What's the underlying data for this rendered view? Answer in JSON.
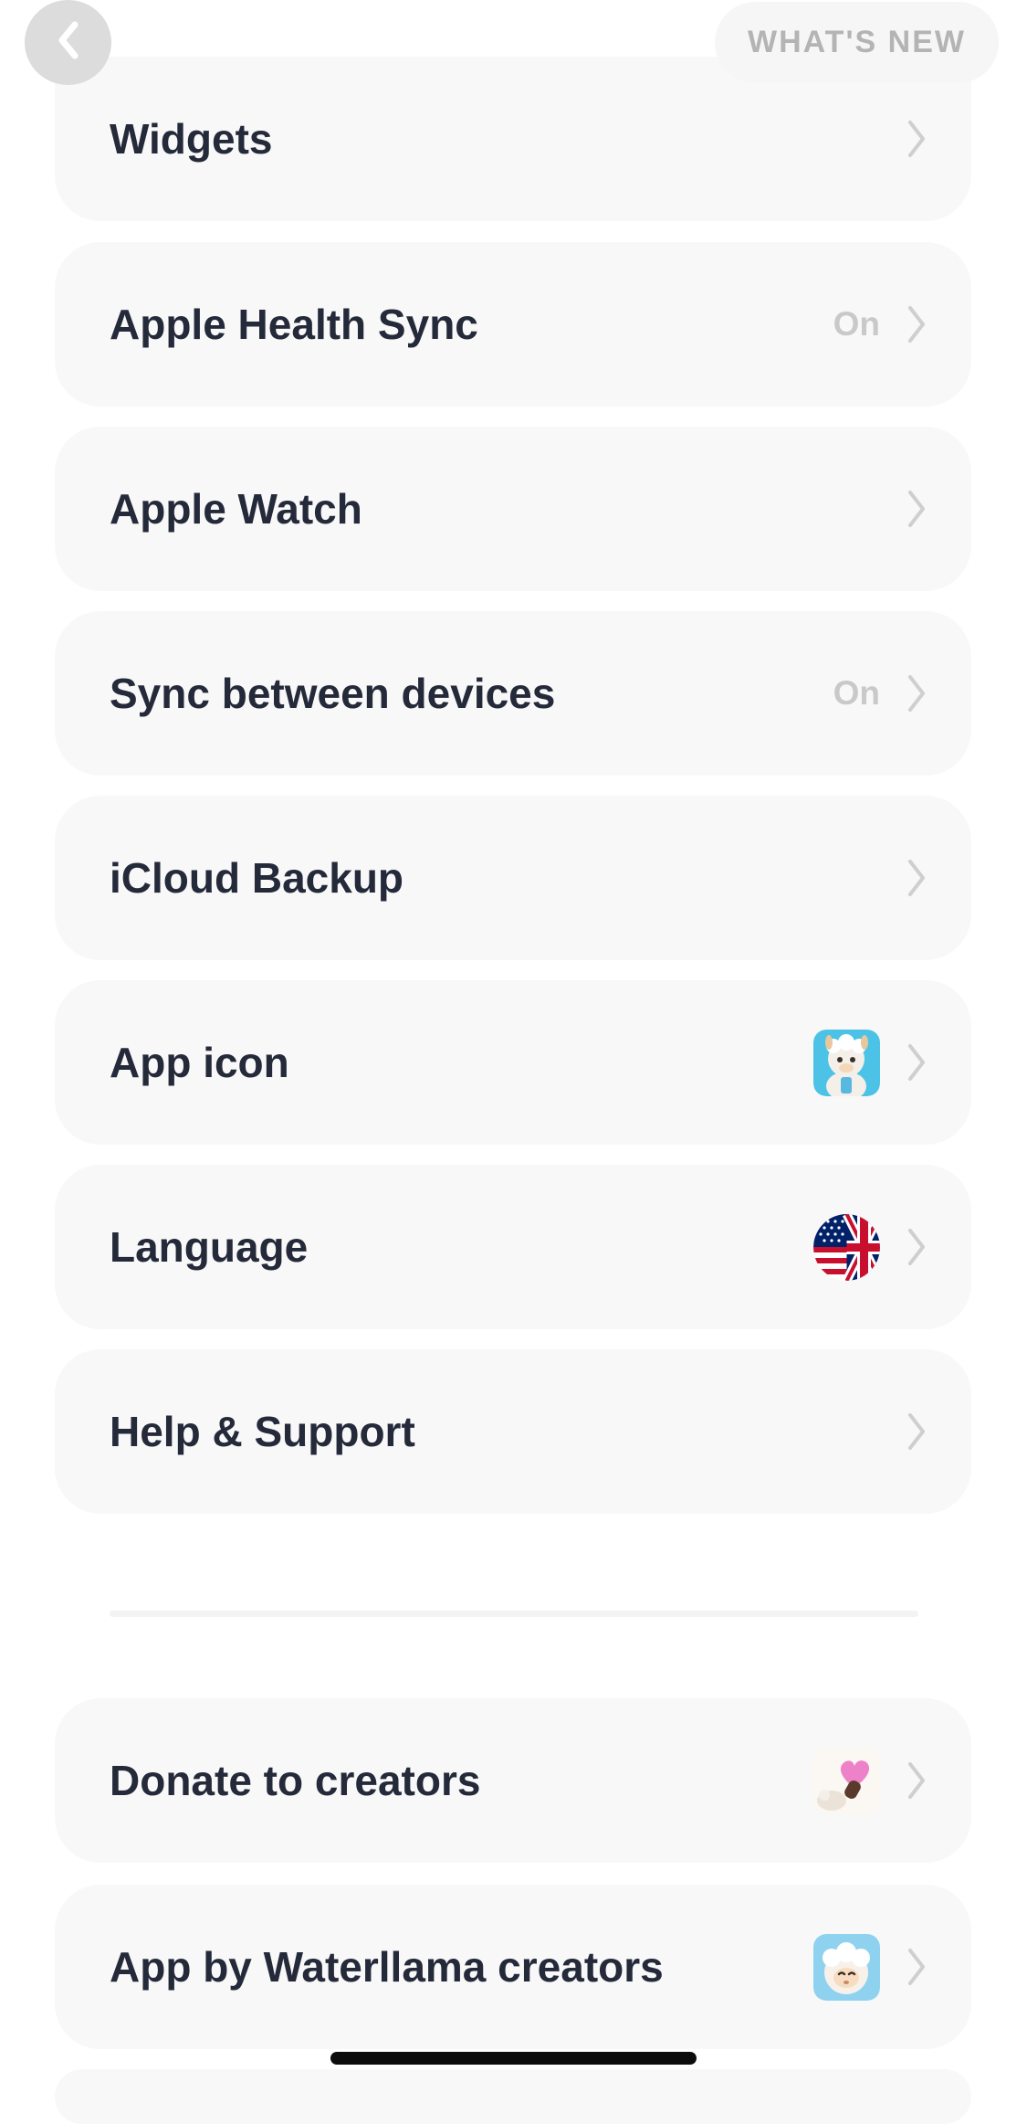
{
  "header": {
    "back_icon": "chevron-left-icon",
    "whats_new_label": "WHAT'S NEW"
  },
  "settings": {
    "rows": [
      {
        "label": "Widgets",
        "value": "",
        "accessory": "none"
      },
      {
        "label": "Apple Health Sync",
        "value": "On",
        "accessory": "none"
      },
      {
        "label": "Apple Watch",
        "value": "",
        "accessory": "none"
      },
      {
        "label": "Sync between devices",
        "value": "On",
        "accessory": "none"
      },
      {
        "label": "iCloud Backup",
        "value": "",
        "accessory": "none"
      },
      {
        "label": "App icon",
        "value": "",
        "accessory": "llama-app-icon"
      },
      {
        "label": "Language",
        "value": "",
        "accessory": "uk-us-flag-icon"
      },
      {
        "label": "Help & Support",
        "value": "",
        "accessory": "none"
      }
    ],
    "extra_rows": [
      {
        "label": "Donate to creators",
        "value": "",
        "accessory": "heart-llama-icon"
      },
      {
        "label": "App by Waterllama creators",
        "value": "",
        "accessory": "sheep-app-icon"
      }
    ]
  },
  "colors": {
    "row_background": "#f8f8f8",
    "label_text": "#252a3a",
    "muted_text": "#c9c9c9",
    "chevron": "#cfcfcf"
  }
}
